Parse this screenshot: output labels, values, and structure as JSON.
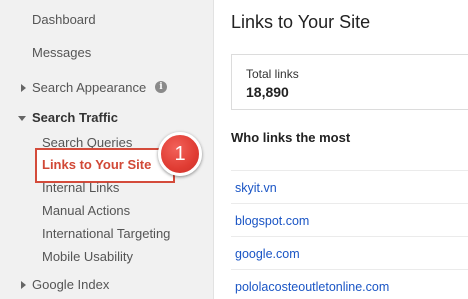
{
  "sidebar": {
    "dashboard": "Dashboard",
    "messages": "Messages",
    "search_appearance": "Search Appearance",
    "search_traffic": "Search Traffic",
    "search_traffic_items": [
      "Search Queries",
      "Links to Your Site",
      "Internal Links",
      "Manual Actions",
      "International Targeting",
      "Mobile Usability"
    ],
    "google_index": "Google Index",
    "info_glyph": "i"
  },
  "callout": {
    "number": "1"
  },
  "main": {
    "title": "Links to Your Site",
    "total_links_label": "Total links",
    "total_links_value": "18,890",
    "who_links_title": "Who links the most",
    "domains": [
      "skyit.vn",
      "blogspot.com",
      "google.com",
      "pololacosteoutletonline.com"
    ]
  },
  "colors": {
    "accent_red": "#d14836",
    "link_blue": "#1a55c5",
    "sidebar_bg": "#f1f1f1"
  }
}
